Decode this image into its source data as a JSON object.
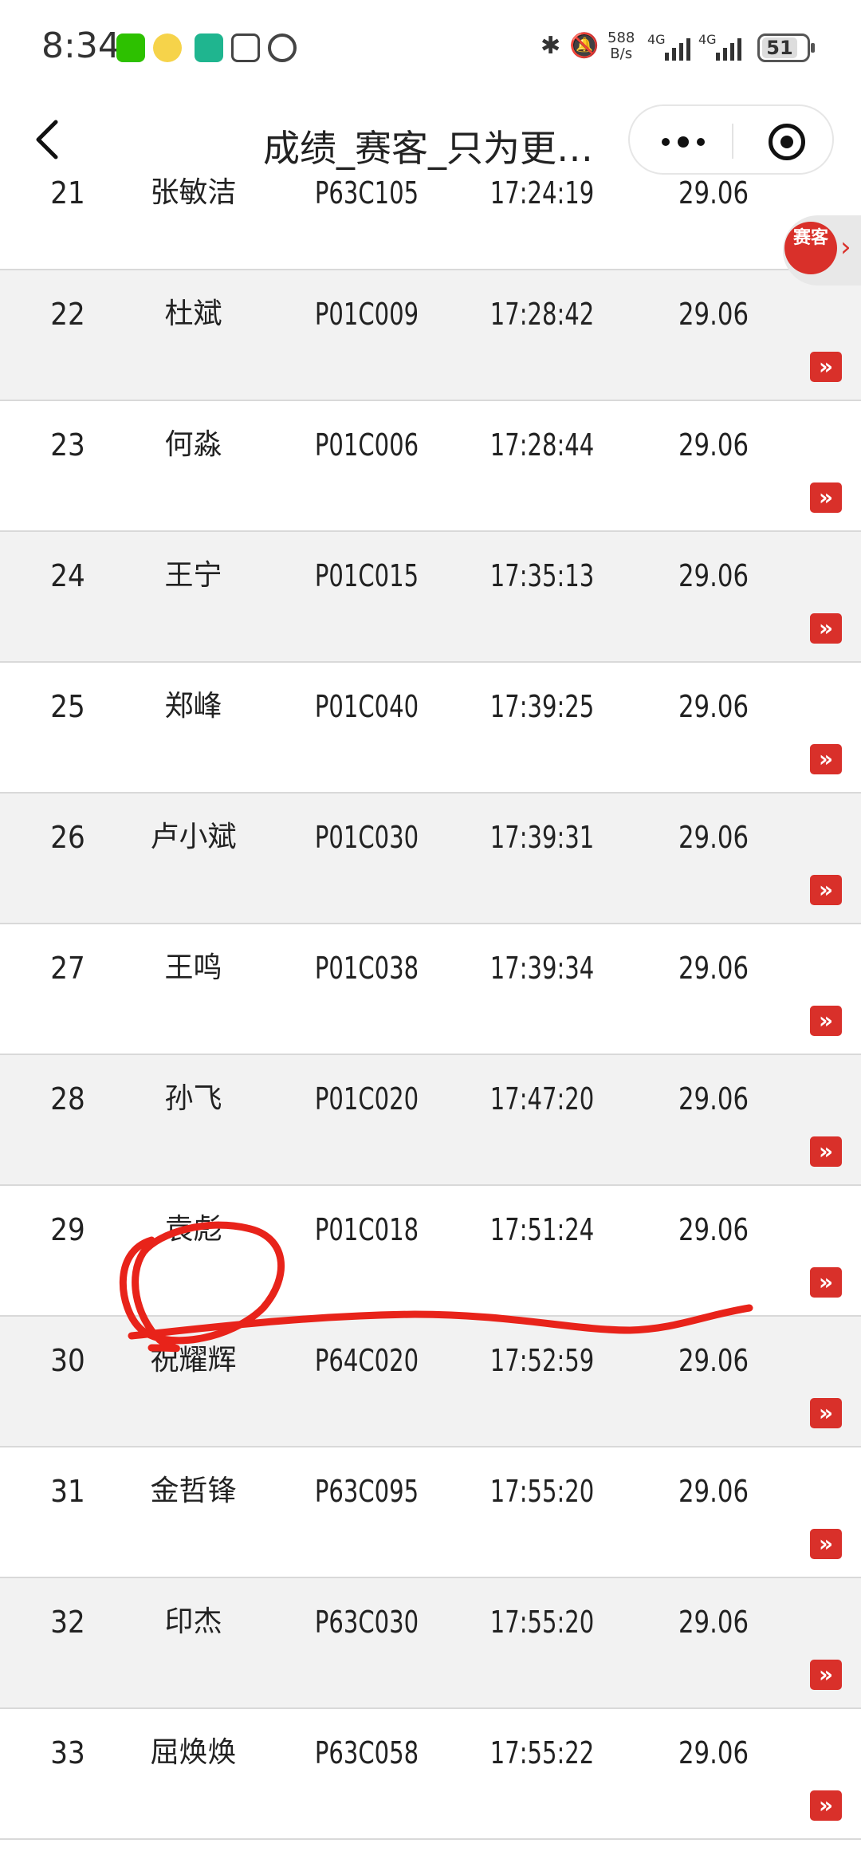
{
  "status_bar": {
    "time": "8:34",
    "net_speed_value": "588",
    "net_speed_unit": "B/s",
    "signal1_label": "4G",
    "signal2_label": "4G",
    "battery": "51"
  },
  "nav": {
    "title": "成绩_赛客_只为更…"
  },
  "float_logo": {
    "text": "赛客"
  },
  "table": {
    "rows": [
      {
        "rank": "21",
        "name": "张敏洁",
        "bib": "P63C105",
        "time": "17:24:19",
        "pace": "29.06"
      },
      {
        "rank": "22",
        "name": "杜斌",
        "bib": "P01C009",
        "time": "17:28:42",
        "pace": "29.06"
      },
      {
        "rank": "23",
        "name": "何淼",
        "bib": "P01C006",
        "time": "17:28:44",
        "pace": "29.06"
      },
      {
        "rank": "24",
        "name": "王宁",
        "bib": "P01C015",
        "time": "17:35:13",
        "pace": "29.06"
      },
      {
        "rank": "25",
        "name": "郑峰",
        "bib": "P01C040",
        "time": "17:39:25",
        "pace": "29.06"
      },
      {
        "rank": "26",
        "name": "卢小斌",
        "bib": "P01C030",
        "time": "17:39:31",
        "pace": "29.06"
      },
      {
        "rank": "27",
        "name": "王鸣",
        "bib": "P01C038",
        "time": "17:39:34",
        "pace": "29.06"
      },
      {
        "rank": "28",
        "name": "孙飞",
        "bib": "P01C020",
        "time": "17:47:20",
        "pace": "29.06"
      },
      {
        "rank": "29",
        "name": "袁彪",
        "bib": "P01C018",
        "time": "17:51:24",
        "pace": "29.06"
      },
      {
        "rank": "30",
        "name": "祝耀辉",
        "bib": "P64C020",
        "time": "17:52:59",
        "pace": "29.06"
      },
      {
        "rank": "31",
        "name": "金哲锋",
        "bib": "P63C095",
        "time": "17:55:20",
        "pace": "29.06"
      },
      {
        "rank": "32",
        "name": "印杰",
        "bib": "P63C030",
        "time": "17:55:20",
        "pace": "29.06"
      },
      {
        "rank": "33",
        "name": "屈焕焕",
        "bib": "P63C058",
        "time": "17:55:22",
        "pace": "29.06"
      }
    ]
  },
  "colors": {
    "accent_red": "#d9302a",
    "row_alt": "#f2f2f2",
    "annotation": "#e8231a"
  },
  "icons": {
    "row_action": "double-chevron-right-icon",
    "back": "chevron-left-icon",
    "more": "more-dots-icon",
    "close": "target-circle-icon"
  }
}
